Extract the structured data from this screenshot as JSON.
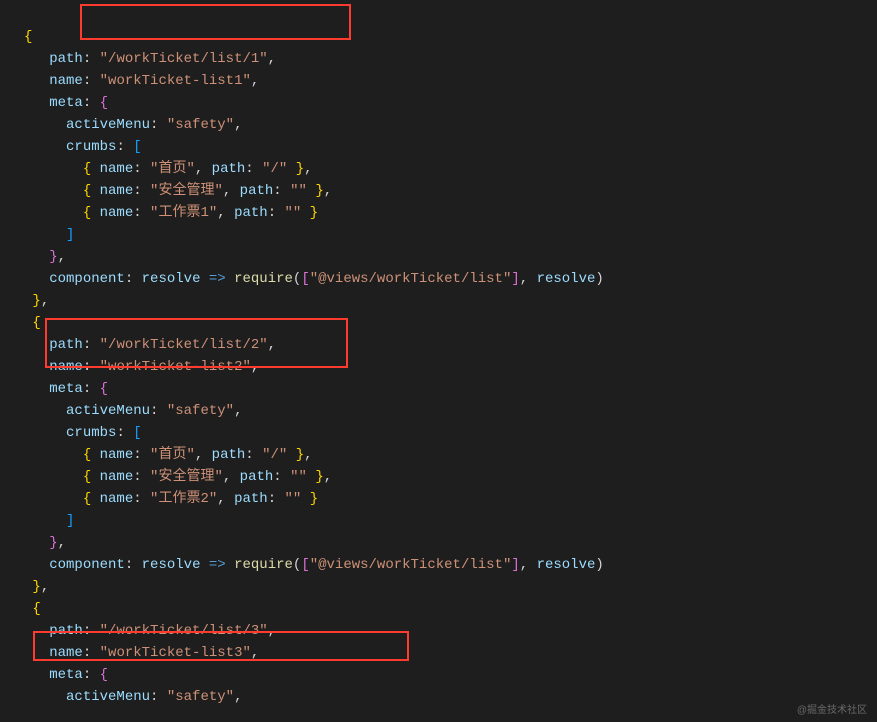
{
  "watermark": "@掘金技术社区",
  "code": {
    "r1": {
      "path_k": "path",
      "path_v": "\"/workTicket/list/1\""
    },
    "r2": {
      "name_k": "name",
      "name_v": "\"workTicket-list1\""
    },
    "r3": {
      "meta_k": "meta"
    },
    "r4": {
      "am_k": "activeMenu",
      "am_v": "\"safety\""
    },
    "r5": {
      "cr_k": "crumbs"
    },
    "r6a": {
      "n_k": "name",
      "n_v": "\"首页\"",
      "p_k": "path",
      "p_v": "\"/\""
    },
    "r6b": {
      "n_k": "name",
      "n_v": "\"安全管理\"",
      "p_k": "path",
      "p_v": "\"\""
    },
    "r6c": {
      "n_k": "name",
      "n_v": "\"工作票1\"",
      "p_k": "path",
      "p_v": "\"\""
    },
    "r7": {
      "cmp_k": "component",
      "res": "resolve",
      "req": "require",
      "arg": "\"@views/workTicket/list\""
    },
    "s1": {
      "path_k": "path",
      "path_v": "\"/workTicket/list/2\""
    },
    "s2": {
      "name_k": "name",
      "name_v": "\"workTicket-list2\""
    },
    "s3": {
      "meta_k": "meta"
    },
    "s4": {
      "am_k": "activeMenu",
      "am_v": "\"safety\""
    },
    "s5": {
      "cr_k": "crumbs"
    },
    "s6a": {
      "n_k": "name",
      "n_v": "\"首页\"",
      "p_k": "path",
      "p_v": "\"/\""
    },
    "s6b": {
      "n_k": "name",
      "n_v": "\"安全管理\"",
      "p_k": "path",
      "p_v": "\"\""
    },
    "s6c": {
      "n_k": "name",
      "n_v": "\"工作票2\"",
      "p_k": "path",
      "p_v": "\"\""
    },
    "s7": {
      "cmp_k": "component",
      "res": "resolve",
      "req": "require",
      "arg": "\"@views/workTicket/list\""
    },
    "t1": {
      "path_k": "path",
      "path_v": "\"/workTicket/list/3\""
    },
    "t2": {
      "name_k": "name",
      "name_v": "\"workTicket-list3\""
    },
    "t3": {
      "meta_k": "meta"
    },
    "t4": {
      "am_k": "activeMenu",
      "am_v": "\"safety\""
    }
  }
}
